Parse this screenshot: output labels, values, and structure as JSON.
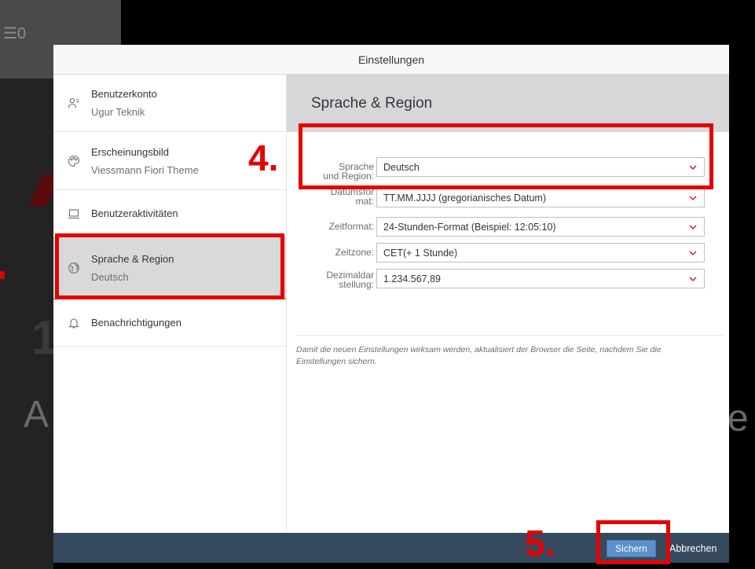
{
  "background": {
    "counter_prefix": "☰",
    "counter_value": "0",
    "bg_digit": "1",
    "bg_letter_left": "A",
    "bg_letter_right": "e"
  },
  "dialog": {
    "title": "Einstellungen",
    "sidebar": [
      {
        "title": "Benutzerkonto",
        "subtitle": "Ugur Teknik",
        "icon": "user-account-icon"
      },
      {
        "title": "Erscheinungsbild",
        "subtitle": "Viessmann Fiori Theme",
        "icon": "palette-icon"
      },
      {
        "title": "Benutzeraktivitäten",
        "subtitle": "",
        "icon": "laptop-icon"
      },
      {
        "title": "Sprache & Region",
        "subtitle": "Deutsch",
        "icon": "globe-icon",
        "selected": true
      },
      {
        "title": "Benachrichtigungen",
        "subtitle": "",
        "icon": "bell-icon"
      }
    ],
    "section_title": "Sprache & Region",
    "fields": [
      {
        "label_line1": "Sprache",
        "label_line2": "und Region:",
        "value": "Deutsch"
      },
      {
        "label_line1": "Datumsfor",
        "label_line2": "mat:",
        "value": "TT.MM.JJJJ (gregorianisches Datum)"
      },
      {
        "label_line1": "Zeitformat:",
        "label_line2": "",
        "value": "24-Stunden-Format (Beispiel: 12:05:10)"
      },
      {
        "label_line1": "Zeitzone:",
        "label_line2": "",
        "value": "CET(+ 1 Stunde)"
      },
      {
        "label_line1": "Dezimaldar",
        "label_line2": "stellung:",
        "value": "1.234.567,89"
      }
    ],
    "note": "Damit die neuen Einstellungen wirksam werden, aktualisiert der Browser die Seite, nachdem Sie die Einstellungen sichern.",
    "footer": {
      "save_label": "Sichern",
      "cancel_label": "Abbrechen"
    }
  },
  "annotations": {
    "step4": "4.",
    "step5": "5."
  },
  "colors": {
    "highlight": "#e60000",
    "footer_bg": "#354a5f",
    "save_button": "#5b90c9",
    "selected_item": "#d9d9db",
    "chevron": "#e60000"
  }
}
